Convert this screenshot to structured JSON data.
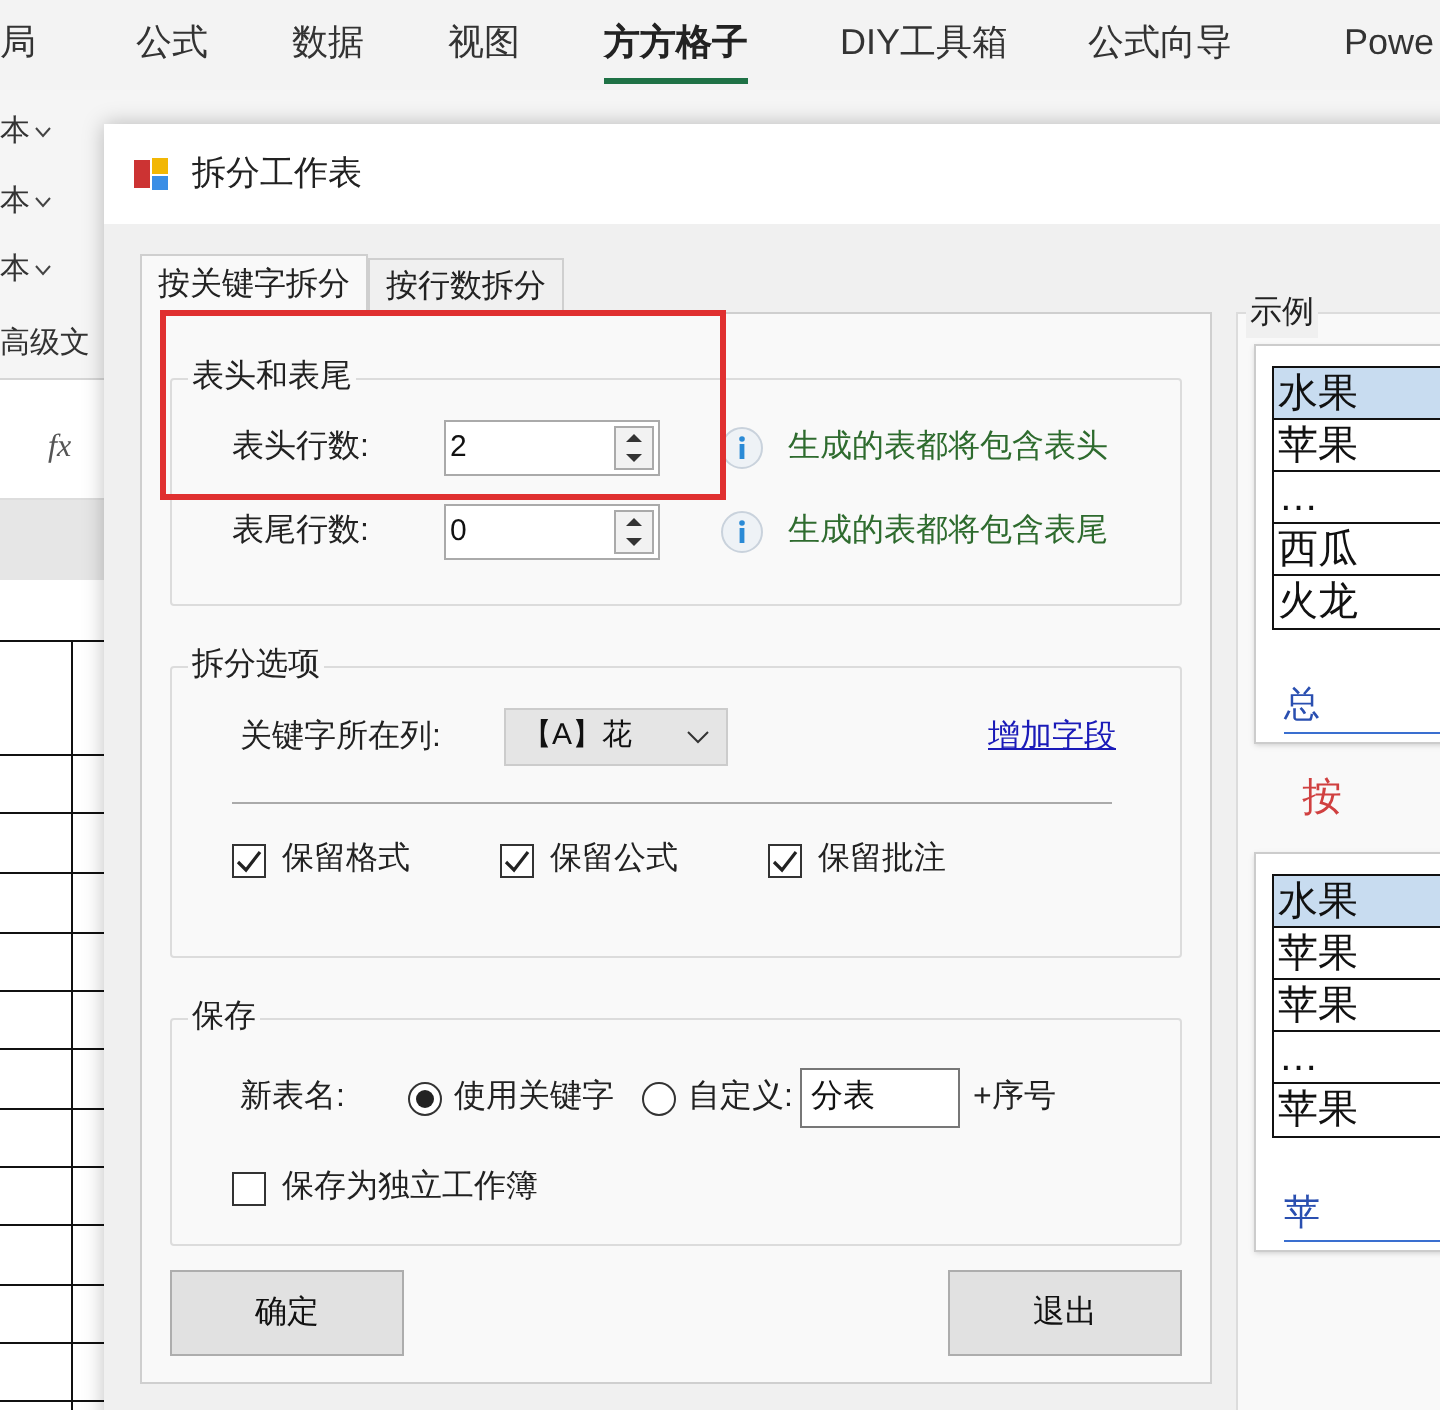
{
  "excel": {
    "ribbon_tabs": [
      {
        "label": "局",
        "selected": false
      },
      {
        "label": "公式",
        "selected": false
      },
      {
        "label": "数据",
        "selected": false
      },
      {
        "label": "视图",
        "selected": false
      },
      {
        "label": "方方格子",
        "selected": true
      },
      {
        "label": "DIY工具箱",
        "selected": false
      },
      {
        "label": "公式向导",
        "selected": false
      },
      {
        "label": "Powe",
        "selected": false
      }
    ],
    "ribbon_items": [
      "本",
      "本",
      "本"
    ],
    "group_label": "高级文",
    "formula_label": "fx"
  },
  "dialog": {
    "title": "拆分工作表",
    "tabs": [
      {
        "label": "按关键字拆分",
        "selected": true
      },
      {
        "label": "按行数拆分",
        "selected": false
      }
    ],
    "header_footer": {
      "title": "表头和表尾",
      "rows": [
        {
          "label": "表头行数:",
          "value": "2",
          "note": "生成的表都将包含表头"
        },
        {
          "label": "表尾行数:",
          "value": "0",
          "note": "生成的表都将包含表尾"
        }
      ]
    },
    "split_options": {
      "title": "拆分选项",
      "key_column_label": "关键字所在列:",
      "key_column_value": "【A】花",
      "link": "增加字段",
      "checkboxes": [
        {
          "label": "保留格式",
          "checked": true
        },
        {
          "label": "保留公式",
          "checked": true
        },
        {
          "label": "保留批注",
          "checked": true
        }
      ]
    },
    "save": {
      "title": "保存",
      "name_label": "新表名:",
      "radios": [
        {
          "label": "使用关键字",
          "selected": true
        },
        {
          "label": "自定义:",
          "selected": false
        }
      ],
      "custom_value": "分表",
      "suffix": "+序号",
      "checkboxes": [
        {
          "label": "保存为独立工作簿",
          "checked": false
        }
      ]
    },
    "buttons": [
      "确定",
      "退出"
    ],
    "example": {
      "title": "示例",
      "caption": "按",
      "cards": [
        {
          "rows": [
            {
              "text": "水果",
              "header": true
            },
            {
              "text": "苹果",
              "header": false
            },
            {
              "text": "…",
              "header": false
            },
            {
              "text": "西瓜",
              "header": false
            },
            {
              "text": "火龙",
              "header": false
            }
          ],
          "sheet_tab": "总"
        },
        {
          "rows": [
            {
              "text": "水果",
              "header": true
            },
            {
              "text": "苹果",
              "header": false
            },
            {
              "text": "苹果",
              "header": false
            },
            {
              "text": "…",
              "header": false
            },
            {
              "text": "苹果",
              "header": false
            }
          ],
          "sheet_tab": "苹"
        }
      ]
    }
  }
}
